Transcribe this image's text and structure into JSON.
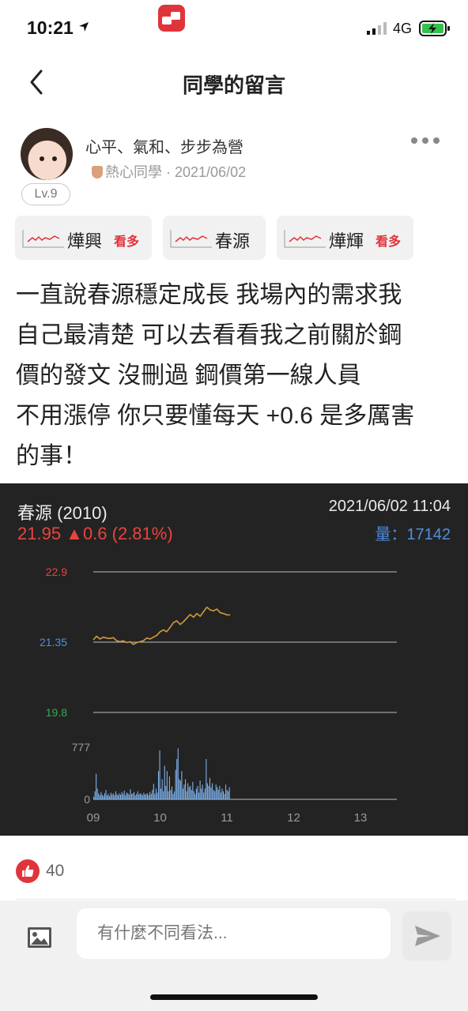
{
  "status": {
    "time": "10:21",
    "network": "4G"
  },
  "nav": {
    "title": "同學的留言"
  },
  "author": {
    "name": "心平、氣和、步步為營",
    "badge": "熱心同學",
    "date": "2021/06/02",
    "level": "Lv.9"
  },
  "tags": [
    {
      "name": "燁興",
      "hot": "看多"
    },
    {
      "name": "春源",
      "hot": ""
    },
    {
      "name": "燁輝",
      "hot": "看多"
    }
  ],
  "post": {
    "lines": [
      "一直說春源穩定成長 我場內的需求我",
      "自己最清楚 可以去看看我之前關於鋼",
      "價的發文 沒刪過 鋼價第一線人員",
      "不用漲停 你只要懂每天 +0.6 是多厲害",
      "的事！"
    ]
  },
  "chart_header": {
    "name": "春源 (2010)",
    "datetime": "2021/06/02 11:04",
    "price_line": "21.95 ▲0.6 (2.81%)",
    "volume_line": "量：17142"
  },
  "chart_data": {
    "type": "line",
    "title": "",
    "price_axis": {
      "ticks": [
        "22.9",
        "21.35",
        "19.8"
      ],
      "range": [
        19.8,
        22.9
      ],
      "tick_colors": [
        "#e8443f",
        "#4f8fe0",
        "#2fae52"
      ]
    },
    "volume_axis": {
      "ticks": [
        "777",
        "0"
      ],
      "range": [
        0,
        777
      ]
    },
    "x_ticks": [
      "09",
      "10",
      "11",
      "12",
      "13"
    ],
    "price_series": {
      "name": "",
      "color": "#d19a3a",
      "x_hours": [
        9.0,
        9.05,
        9.1,
        9.15,
        9.2,
        9.25,
        9.3,
        9.35,
        9.4,
        9.45,
        9.5,
        9.55,
        9.6,
        9.65,
        9.7,
        9.75,
        9.8,
        9.85,
        9.9,
        9.95,
        10.0,
        10.05,
        10.1,
        10.15,
        10.2,
        10.25,
        10.3,
        10.35,
        10.4,
        10.45,
        10.5,
        10.55,
        10.6,
        10.65,
        10.7,
        10.75,
        10.8,
        10.85,
        10.9,
        10.95,
        11.0,
        11.05
      ],
      "values": [
        21.4,
        21.48,
        21.42,
        21.46,
        21.44,
        21.43,
        21.45,
        21.38,
        21.36,
        21.38,
        21.34,
        21.36,
        21.3,
        21.34,
        21.36,
        21.38,
        21.44,
        21.42,
        21.46,
        21.5,
        21.58,
        21.62,
        21.58,
        21.68,
        21.78,
        21.82,
        21.74,
        21.8,
        21.88,
        21.96,
        21.9,
        21.98,
        21.92,
        22.02,
        22.12,
        22.06,
        22.04,
        22.08,
        22.0,
        21.98,
        21.95,
        21.95
      ]
    },
    "volume_series": {
      "name": "",
      "color": "#7fb2ec",
      "values": [
        40,
        120,
        380,
        160,
        90,
        60,
        110,
        70,
        50,
        90,
        140,
        60,
        80,
        50,
        100,
        70,
        90,
        60,
        120,
        80,
        60,
        90,
        70,
        110,
        80,
        130,
        60,
        100,
        90,
        70,
        150,
        80,
        90,
        110,
        60,
        80,
        120,
        70,
        90,
        80,
        60,
        100,
        70,
        80,
        90,
        60,
        110,
        80,
        140,
        230,
        80,
        160,
        100,
        420,
        730,
        160,
        300,
        120,
        500,
        200,
        420,
        120,
        340,
        140,
        190,
        80,
        120,
        440,
        600,
        760,
        300,
        280,
        420,
        160,
        220,
        300,
        120,
        240,
        180,
        200,
        140,
        260,
        120,
        80,
        160,
        200,
        100,
        280,
        160,
        220,
        100,
        160,
        600,
        240,
        200,
        320,
        180,
        240,
        140,
        120,
        220,
        180,
        140,
        200,
        100,
        160,
        120,
        80,
        220,
        140,
        120,
        180
      ]
    }
  },
  "reactions": {
    "likes": "40"
  },
  "composer": {
    "placeholder": "有什麼不同看法..."
  }
}
